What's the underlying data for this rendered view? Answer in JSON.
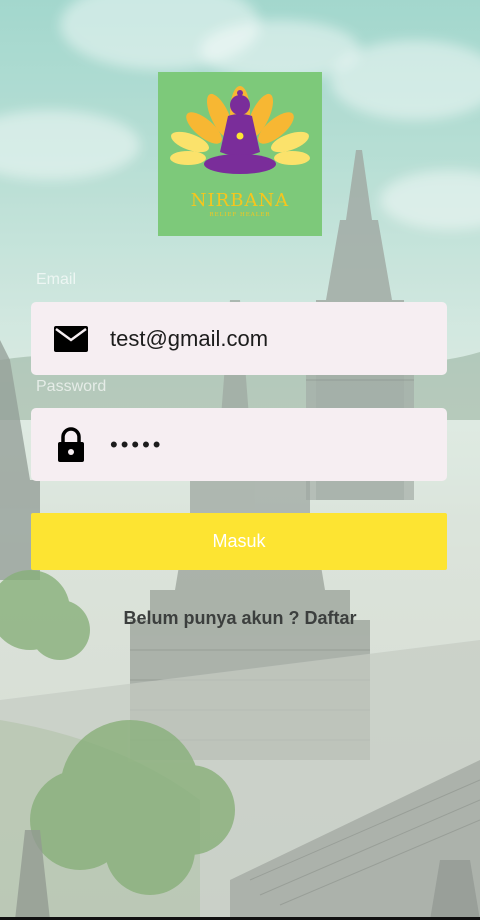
{
  "brand": {
    "name": "NIRBANA",
    "tagline": "RELIEF HEALER",
    "bg_color": "#7dc97a",
    "text_color": "#f6c61d"
  },
  "email": {
    "label": "Email",
    "value": "test@gmail.com",
    "icon": "envelope-icon"
  },
  "password": {
    "label": "Password",
    "value": "•••••",
    "icon": "lock-icon"
  },
  "login_button": {
    "label": "Masuk",
    "color": "#fde432"
  },
  "register_link": {
    "label": "Belum punya akun ? Daftar"
  }
}
